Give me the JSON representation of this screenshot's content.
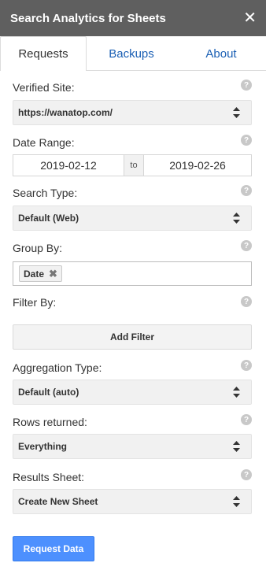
{
  "header": {
    "title": "Search Analytics for Sheets",
    "close": "✕"
  },
  "tabs": [
    {
      "label": "Requests",
      "active": true
    },
    {
      "label": "Backups"
    },
    {
      "label": "About"
    }
  ],
  "help_glyph": "?",
  "form": {
    "verified_site": {
      "label": "Verified Site:",
      "value": "https://wanatop.com/"
    },
    "date_range": {
      "label": "Date Range:",
      "start": "2019-02-12",
      "to": "to",
      "end": "2019-02-26"
    },
    "search_type": {
      "label": "Search Type:",
      "value": "Default (Web)"
    },
    "group_by": {
      "label": "Group By:",
      "chip": "Date",
      "chip_remove": "✖"
    },
    "filter_by": {
      "label": "Filter By:",
      "add_button": "Add Filter"
    },
    "aggregation_type": {
      "label": "Aggregation Type:",
      "value": "Default (auto)"
    },
    "rows_returned": {
      "label": "Rows returned:",
      "value": "Everything"
    },
    "results_sheet": {
      "label": "Results Sheet:",
      "value": "Create New Sheet"
    }
  },
  "actions": {
    "request_data": "Request Data"
  },
  "colors": {
    "titlebar": "#5f5f5f",
    "tab_link": "#1a5fb4",
    "primary_button": "#4d90fe",
    "help_icon": "#c8c8c8"
  }
}
